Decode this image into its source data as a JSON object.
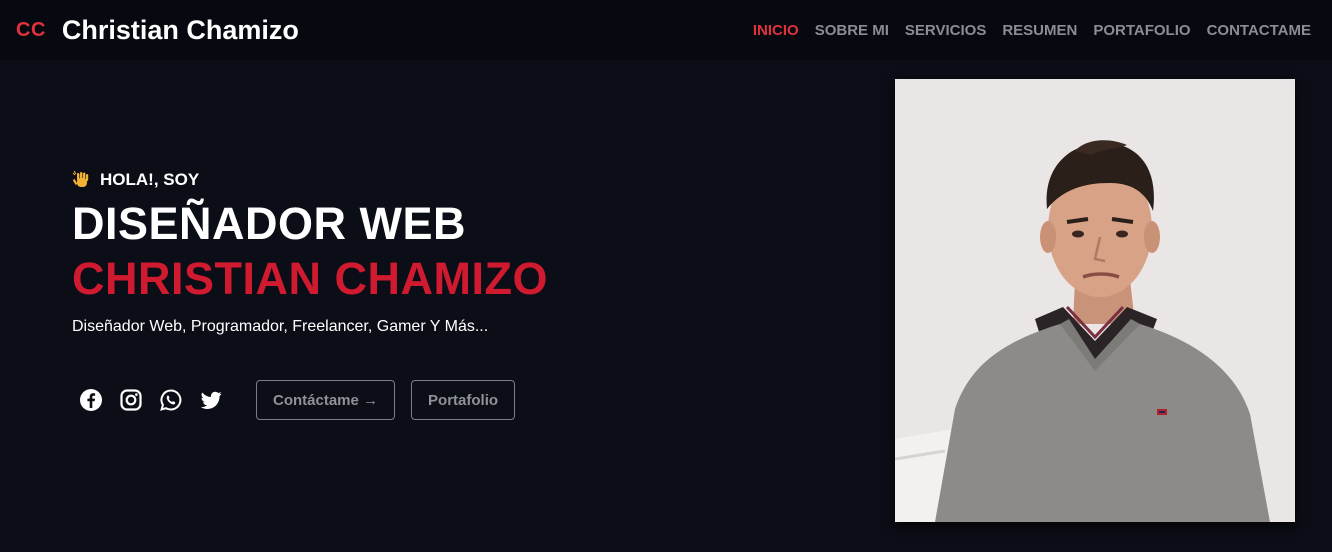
{
  "brand": {
    "mark": "CC",
    "name": "Christian Chamizo"
  },
  "nav": {
    "items": [
      {
        "label": "INICIO",
        "active": true
      },
      {
        "label": "SOBRE MI",
        "active": false
      },
      {
        "label": "SERVICIOS",
        "active": false
      },
      {
        "label": "RESUMEN",
        "active": false
      },
      {
        "label": "PORTAFOLIO",
        "active": false
      },
      {
        "label": "CONTACTAME",
        "active": false
      }
    ]
  },
  "hero": {
    "greeting": "HOLA!, SOY",
    "greeting_icon": "waving-hand-icon",
    "role": "DISEÑADOR WEB",
    "name": "CHRISTIAN CHAMIZO",
    "tagline": "Diseñador Web, Programador, Freelancer, Gamer Y Más..."
  },
  "socials": [
    "facebook-icon",
    "instagram-icon",
    "whatsapp-icon",
    "twitter-icon"
  ],
  "buttons": {
    "contact": "Contáctame →",
    "portfolio": "Portafolio"
  },
  "colors": {
    "background": "#0b0e16",
    "navbar": "#060910",
    "accent": "#e0313c",
    "name_red": "#d01a30",
    "muted": "#8a8d93"
  }
}
